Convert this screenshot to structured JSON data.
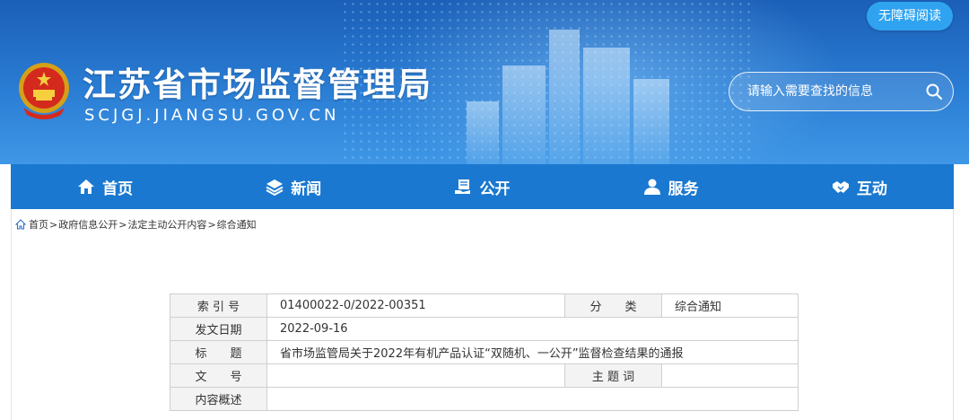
{
  "header": {
    "title": "江苏省市场监督管理局",
    "url": "SCJGJ.JIANGSU.GOV.CN",
    "accessibility_label": "无障碍阅读",
    "search_placeholder": "请输入需要查找的信息"
  },
  "nav": {
    "items": [
      {
        "label": "首页",
        "icon": "home-icon"
      },
      {
        "label": "新闻",
        "icon": "layers-icon"
      },
      {
        "label": "公开",
        "icon": "document-hand-icon"
      },
      {
        "label": "服务",
        "icon": "user-service-icon"
      },
      {
        "label": "互动",
        "icon": "handshake-icon"
      }
    ]
  },
  "breadcrumb": {
    "icon": "home-icon",
    "items": [
      "首页",
      "政府信息公开",
      "法定主动公开内容",
      "综合通知"
    ],
    "separator": ">"
  },
  "meta_table": {
    "index_label": "索 引 号",
    "index_value": "01400022-0/2022-00351",
    "category_label": "分　　类",
    "category_value": "综合通知",
    "date_label": "发文日期",
    "date_value": "2022-09-16",
    "title_label": "标　　题",
    "title_value": "省市场监管局关于2022年有机产品认证“双随机、一公开”监督检查结果的通报",
    "doc_no_label": "文　　号",
    "doc_no_value": "",
    "subject_label": "主 题 词",
    "subject_value": "",
    "summary_label": "内容概述",
    "summary_value": ""
  },
  "colors": {
    "banner_top": "#1b5fb8",
    "banner_bottom": "#3f97e6",
    "nav_bg": "#1a78d0",
    "access_btn": "#2fa3f0",
    "table_label_bg": "#f3f3f3"
  }
}
